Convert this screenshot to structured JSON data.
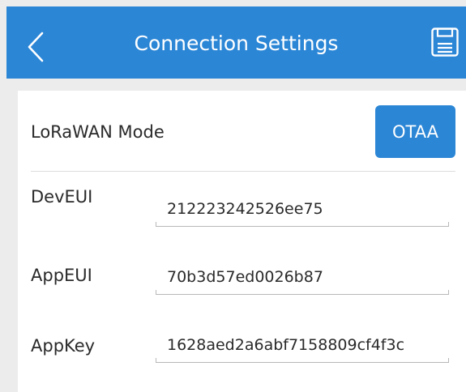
{
  "header": {
    "title": "Connection Settings",
    "back_icon": "chevron-left-icon",
    "save_icon": "floppy-disk-icon",
    "color": "#2b86d6"
  },
  "mode": {
    "label": "LoRaWAN Mode",
    "value": "OTAA"
  },
  "fields": [
    {
      "label": "DevEUI",
      "value": "212223242526ee75"
    },
    {
      "label": "AppEUI",
      "value": "70b3d57ed0026b87"
    },
    {
      "label": "AppKey",
      "value": "1628aed2a6abf7158809cf4f3c"
    }
  ]
}
